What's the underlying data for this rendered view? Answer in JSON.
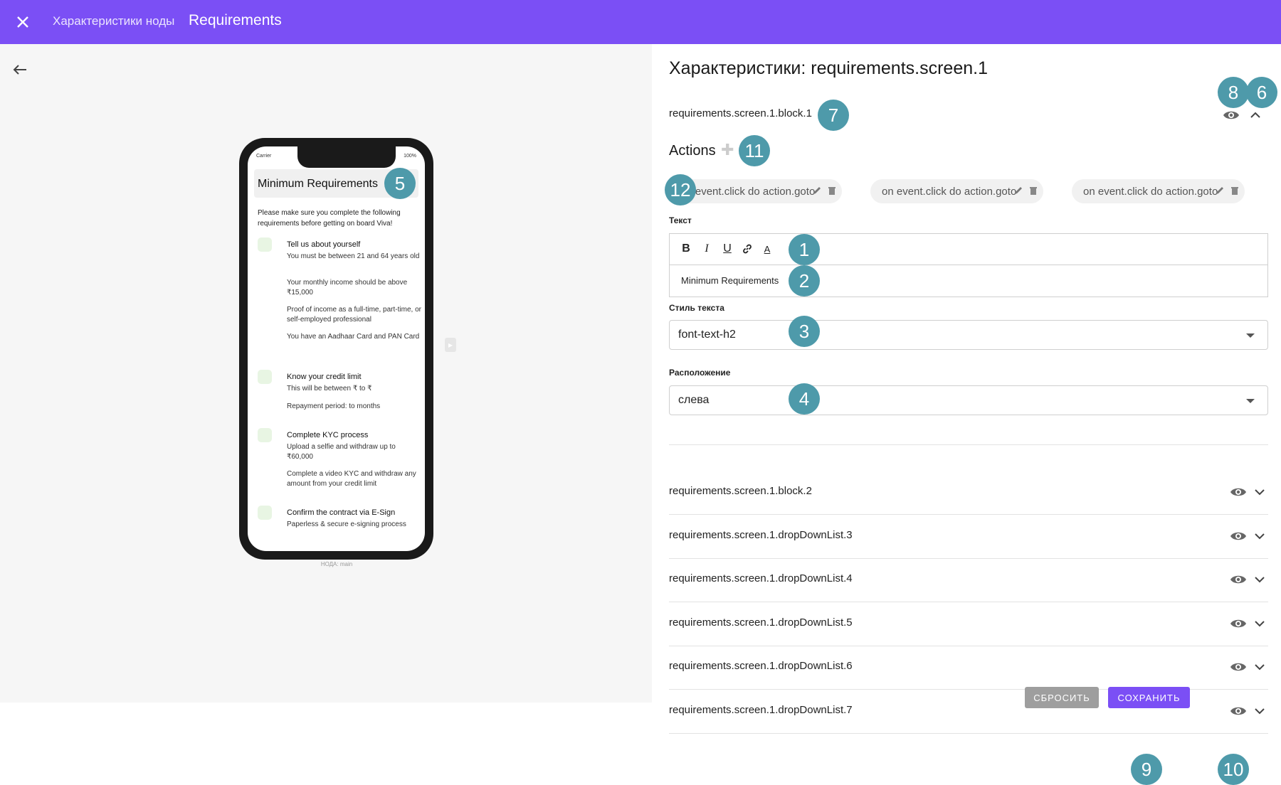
{
  "topbar": {
    "subtitle": "Характеристики ноды",
    "title": "Requirements"
  },
  "preview": {
    "caption": "НОДА: main",
    "status_left": "Carrier",
    "status_right": "100%",
    "header": "Minimum Requirements",
    "intro": "Please make sure you complete the following requirements before getting on board Viva!",
    "sections": [
      {
        "title": "Tell us about yourself",
        "lines": [
          "You must be between 21 and 64 years old",
          "Your monthly income should be above ₹15,000",
          "Proof of income as a full-time, part-time, or self-employed professional",
          "You have an Aadhaar Card and PAN Card"
        ]
      },
      {
        "title": "Know your credit limit",
        "lines": [
          "This will be between ₹ to ₹",
          "Repayment period: to months"
        ]
      },
      {
        "title": "Complete KYC process",
        "lines": [
          "Upload a selfie and withdraw up to ₹60,000",
          "Complete a video KYC and withdraw any amount from your credit limit"
        ]
      },
      {
        "title": "Confirm the contract via E-Sign",
        "lines": [
          "Paperless & secure e-signing process"
        ]
      }
    ]
  },
  "panel": {
    "heading": "Характеристики: requirements.screen.1",
    "block1": "requirements.screen.1.block.1",
    "actions_title": "Actions",
    "chips": [
      "on event.click do action.goto",
      "on event.click do action.goto",
      "on event.click do action.goto"
    ],
    "text_label": "Текст",
    "toolbar": {
      "bold": "B",
      "italic": "I",
      "underline": "U",
      "color": "A"
    },
    "text_value": "Minimum Requirements",
    "style_label": "Стиль текста",
    "style_value": "font-text-h2",
    "position_label": "Расположение",
    "position_value": "слева",
    "blocks": [
      "requirements.screen.1.block.2",
      "requirements.screen.1.dropDownList.3",
      "requirements.screen.1.dropDownList.4",
      "requirements.screen.1.dropDownList.5",
      "requirements.screen.1.dropDownList.6",
      "requirements.screen.1.dropDownList.7"
    ],
    "reset_label": "СБРОСИТЬ",
    "save_label": "СОХРАНИТЬ"
  },
  "badges": [
    "1",
    "2",
    "3",
    "4",
    "5",
    "6",
    "7",
    "8",
    "9",
    "10",
    "11",
    "12"
  ],
  "colors": {
    "accent": "#7b4ff5",
    "badge": "#4e9aaa",
    "reset": "#9e9e9e"
  }
}
